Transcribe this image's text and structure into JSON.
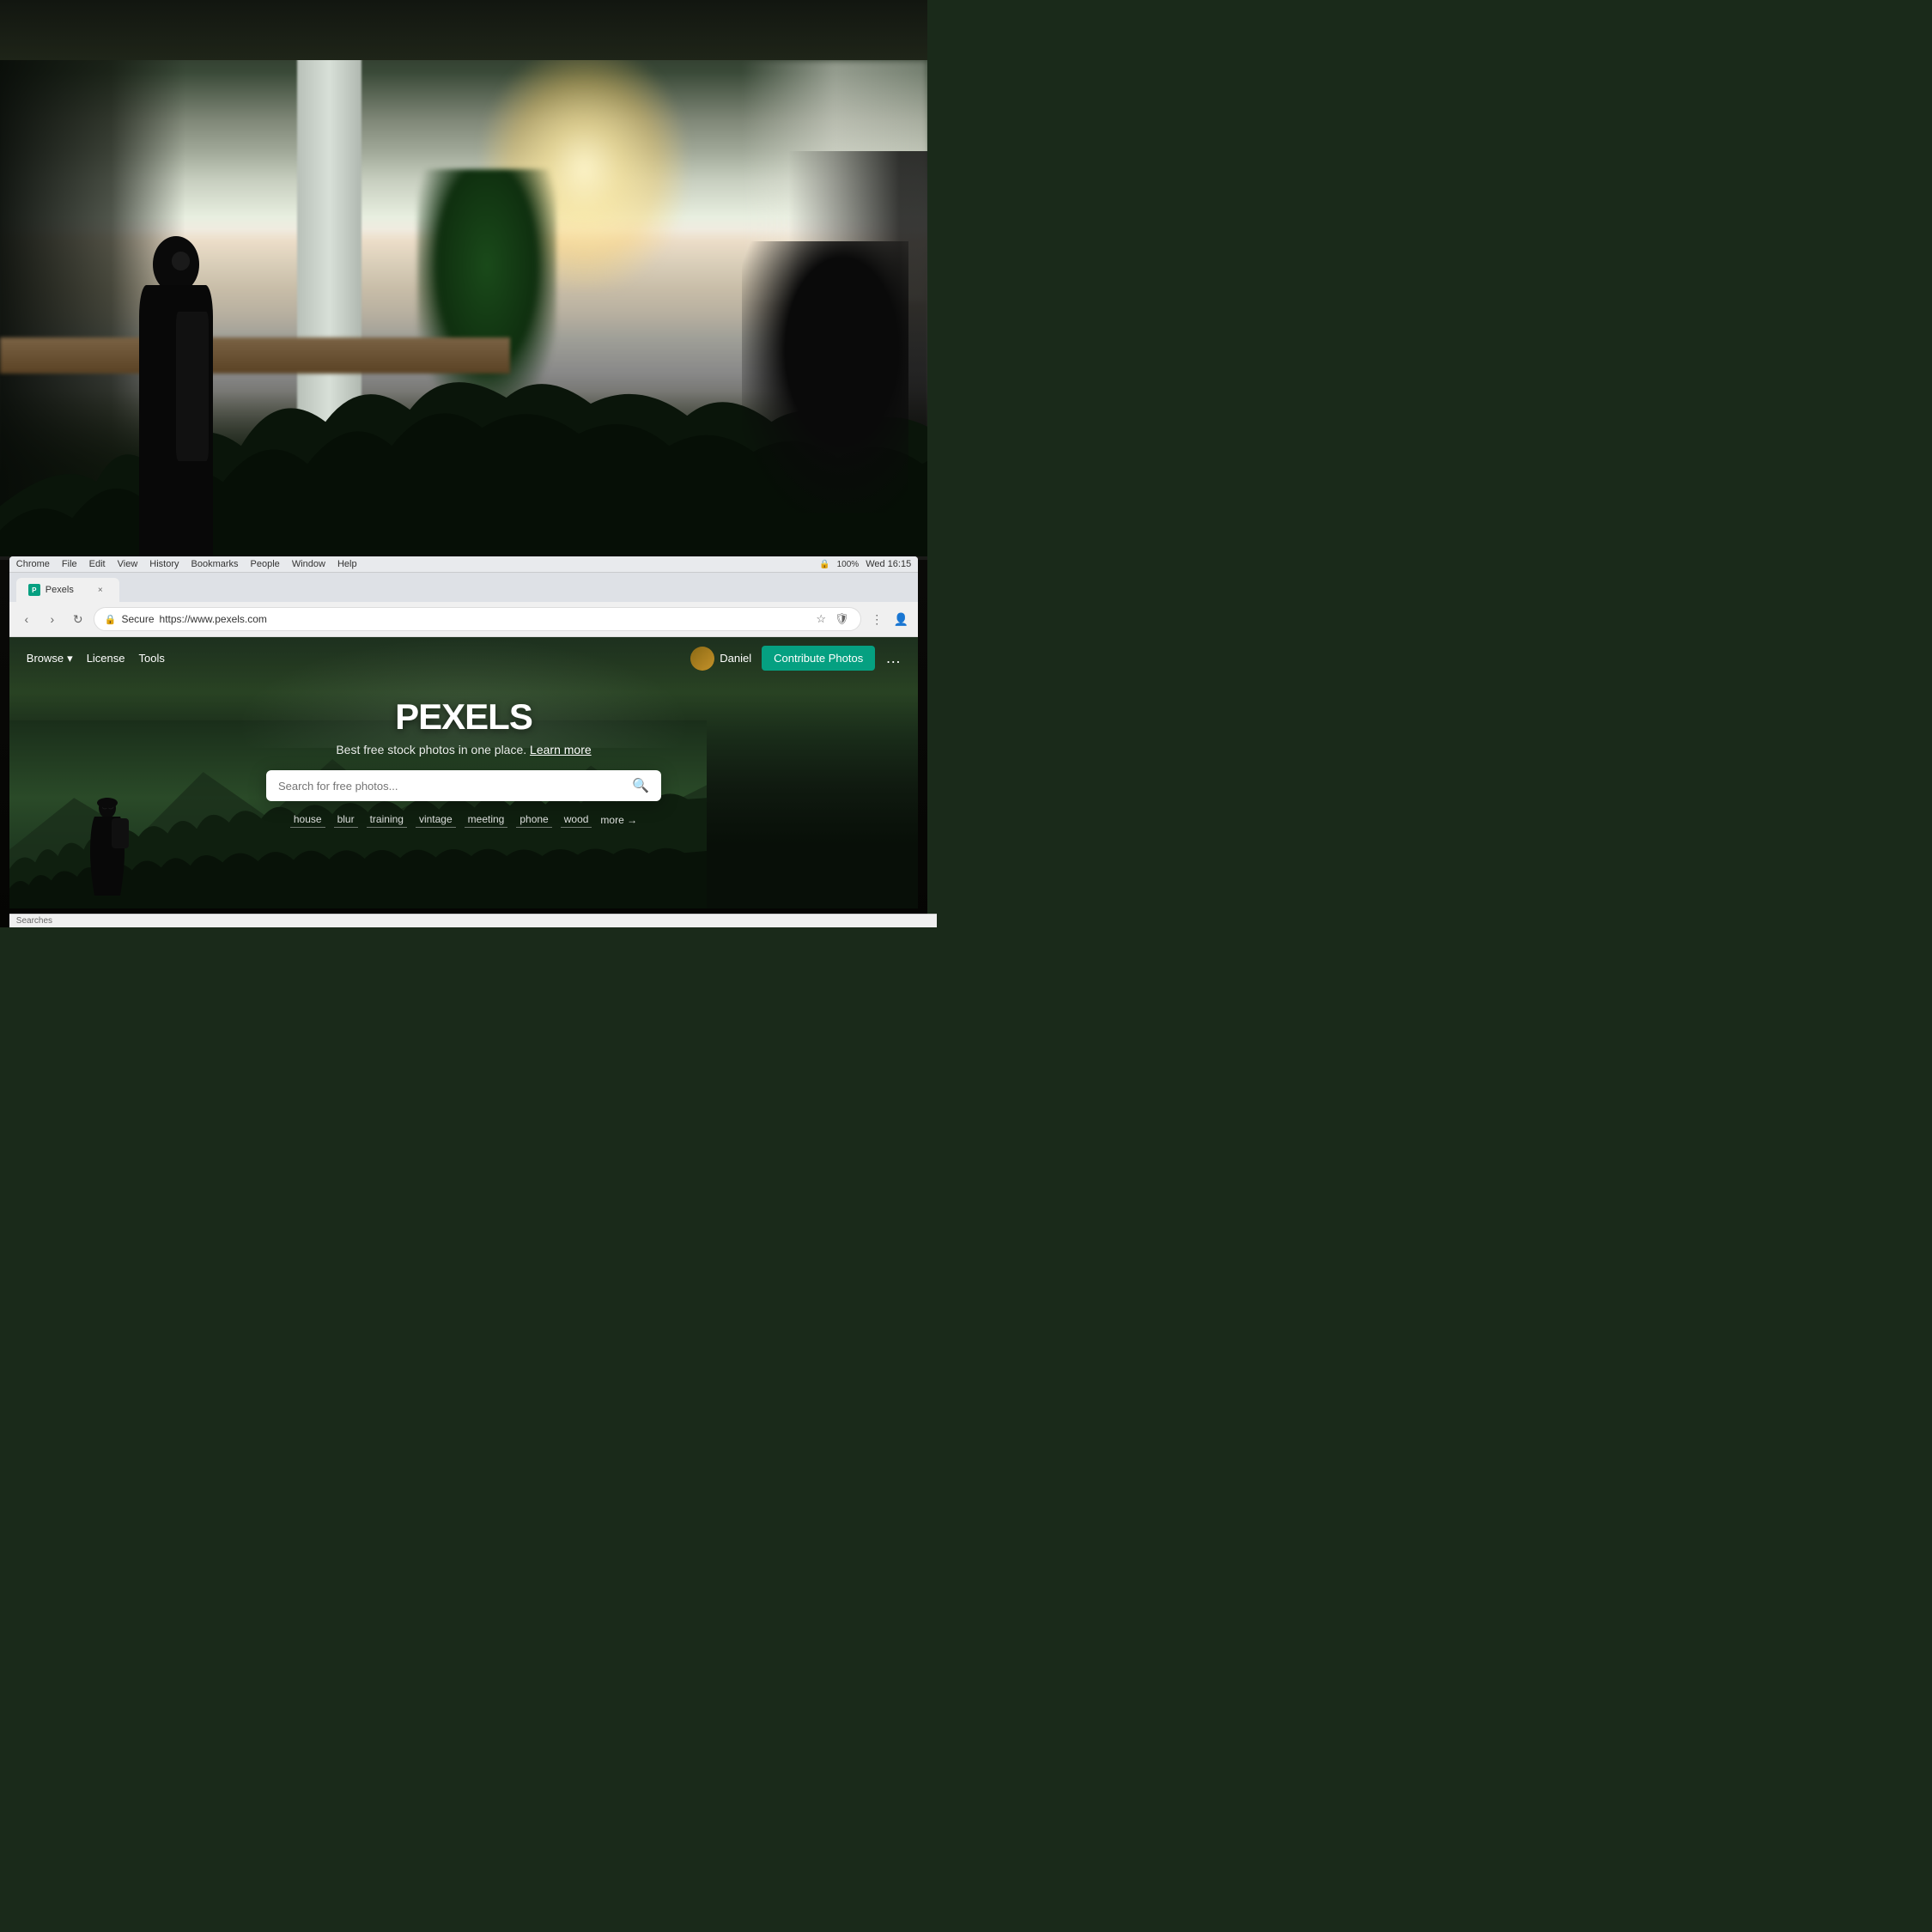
{
  "background": {
    "description": "Office workspace background with bokeh lighting"
  },
  "browser": {
    "menu_items": [
      "Chrome",
      "File",
      "Edit",
      "View",
      "History",
      "Bookmarks",
      "People",
      "Window",
      "Help"
    ],
    "time": "Wed 16:15",
    "battery": "100%",
    "tab": {
      "title": "Pexels",
      "favicon_text": "P",
      "close_label": "×"
    },
    "address": {
      "secure_label": "Secure",
      "url": "https://www.pexels.com",
      "protocol": "https://",
      "domain": "www.pexels.com"
    }
  },
  "pexels": {
    "nav": {
      "browse_label": "Browse",
      "license_label": "License",
      "tools_label": "Tools",
      "user_name": "Daniel",
      "contribute_label": "Contribute Photos",
      "more_label": "…"
    },
    "hero": {
      "logo": "PEXELS",
      "subtitle": "Best free stock photos in one place.",
      "learn_more": "Learn more",
      "search_placeholder": "Search for free photos...",
      "tags": [
        "house",
        "blur",
        "training",
        "vintage",
        "meeting",
        "phone",
        "wood"
      ],
      "more_tag": "more →"
    }
  },
  "bottom_bar": {
    "label": "Searches"
  }
}
